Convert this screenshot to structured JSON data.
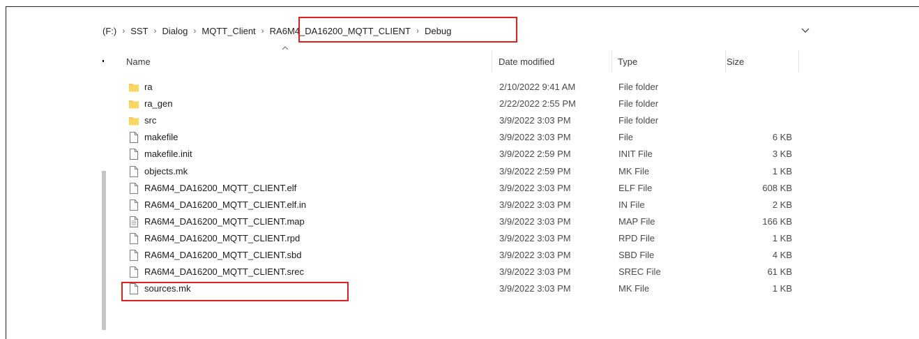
{
  "breadcrumb": {
    "items": [
      "(F:)",
      "SST",
      "Dialog",
      "MQTT_Client",
      "RA6M4_DA16200_MQTT_CLIENT",
      "Debug"
    ],
    "separator": "›"
  },
  "columns": {
    "name": "Name",
    "date_modified": "Date modified",
    "type": "Type",
    "size": "Size",
    "sort_indicator": "^"
  },
  "files": [
    {
      "name": "ra",
      "date": "2/10/2022 9:41 AM",
      "type": "File folder",
      "size": "",
      "icon": "folder-icon"
    },
    {
      "name": "ra_gen",
      "date": "2/22/2022 2:55 PM",
      "type": "File folder",
      "size": "",
      "icon": "folder-icon"
    },
    {
      "name": "src",
      "date": "3/9/2022 3:03 PM",
      "type": "File folder",
      "size": "",
      "icon": "folder-icon"
    },
    {
      "name": "makefile",
      "date": "3/9/2022 3:03 PM",
      "type": "File",
      "size": "6 KB",
      "icon": "file-icon"
    },
    {
      "name": "makefile.init",
      "date": "3/9/2022 2:59 PM",
      "type": "INIT File",
      "size": "3 KB",
      "icon": "file-icon"
    },
    {
      "name": "objects.mk",
      "date": "3/9/2022 2:59 PM",
      "type": "MK File",
      "size": "1 KB",
      "icon": "file-icon"
    },
    {
      "name": "RA6M4_DA16200_MQTT_CLIENT.elf",
      "date": "3/9/2022 3:03 PM",
      "type": "ELF File",
      "size": "608 KB",
      "icon": "file-icon"
    },
    {
      "name": "RA6M4_DA16200_MQTT_CLIENT.elf.in",
      "date": "3/9/2022 3:03 PM",
      "type": "IN File",
      "size": "2 KB",
      "icon": "file-icon"
    },
    {
      "name": "RA6M4_DA16200_MQTT_CLIENT.map",
      "date": "3/9/2022 3:03 PM",
      "type": "MAP File",
      "size": "166 KB",
      "icon": "text-file-icon"
    },
    {
      "name": "RA6M4_DA16200_MQTT_CLIENT.rpd",
      "date": "3/9/2022 3:03 PM",
      "type": "RPD File",
      "size": "1 KB",
      "icon": "file-icon"
    },
    {
      "name": "RA6M4_DA16200_MQTT_CLIENT.sbd",
      "date": "3/9/2022 3:03 PM",
      "type": "SBD File",
      "size": "4 KB",
      "icon": "file-icon"
    },
    {
      "name": "RA6M4_DA16200_MQTT_CLIENT.srec",
      "date": "3/9/2022 3:03 PM",
      "type": "SREC File",
      "size": "61 KB",
      "icon": "file-icon"
    },
    {
      "name": "sources.mk",
      "date": "3/9/2022 3:03 PM",
      "type": "MK File",
      "size": "1 KB",
      "icon": "file-icon"
    }
  ],
  "colors": {
    "highlight": "#e02020",
    "folder": "#f8c447",
    "text": "#1a1a1a"
  }
}
